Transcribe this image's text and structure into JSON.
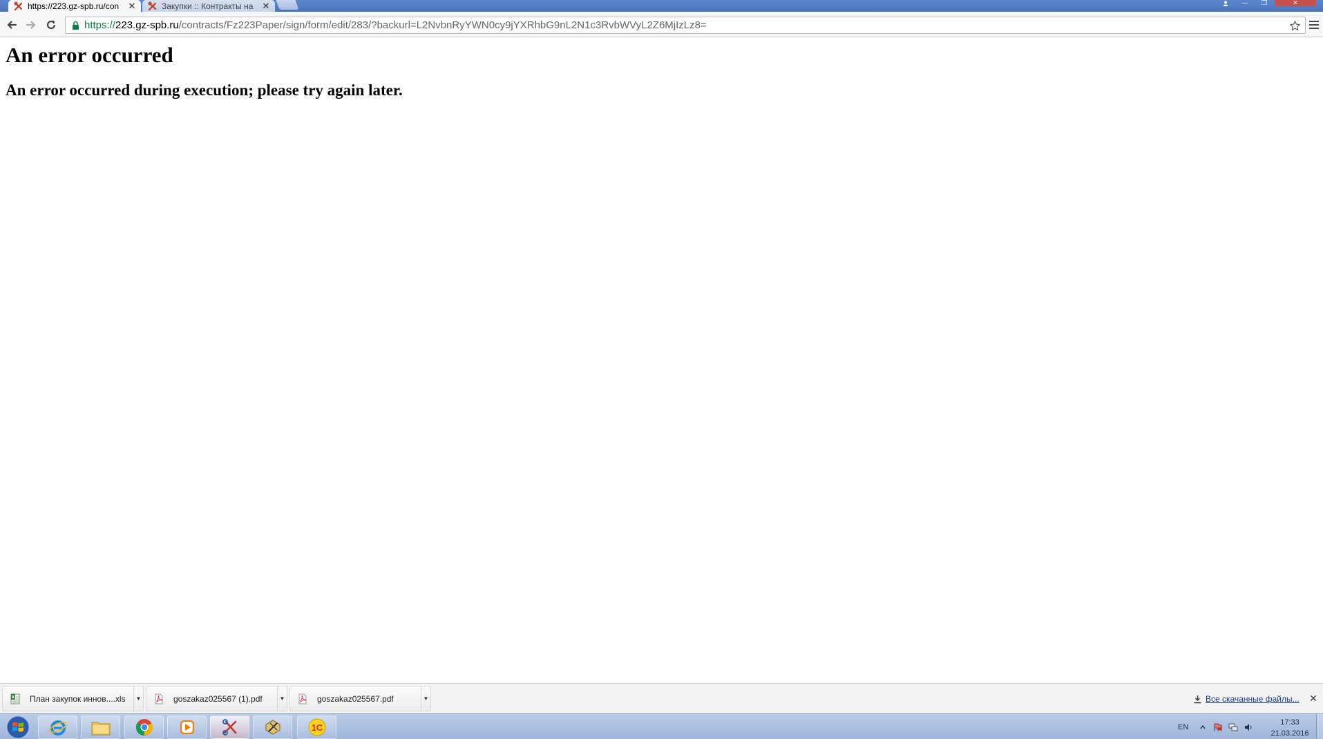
{
  "browser": {
    "tabs": [
      {
        "title": "https://223.gz-spb.ru/con",
        "close": "✕",
        "active": true
      },
      {
        "title": "Закупки :: Контракты на ",
        "close": "✕",
        "active": false
      }
    ],
    "window_controls": {
      "minimize": "—",
      "restore": "❐",
      "close": "✕"
    },
    "url": {
      "scheme": "https://",
      "host": "223.gz-spb.ru",
      "path": "/contracts/Fz223Paper/sign/form/edit/283/?backurl=L2NvbnRyYWN0cy9jYXRhbG9nL2N1c3RvbWVyL2Z6MjIzLz8="
    }
  },
  "page": {
    "heading": "An error occurred",
    "message": "An error occurred during execution; please try again later."
  },
  "downloads": {
    "items": [
      {
        "name": "План закупок иннов....xls",
        "icon": "excel-file-icon"
      },
      {
        "name": "goszakaz025567 (1).pdf",
        "icon": "pdf-file-icon"
      },
      {
        "name": "goszakaz025567.pdf",
        "icon": "pdf-file-icon"
      }
    ],
    "all_files_label": "Все скачанные файлы...",
    "close": "✕"
  },
  "taskbar": {
    "apps": [
      "internet-explorer-icon",
      "file-explorer-icon",
      "chrome-icon",
      "media-player-icon",
      "scissors-app-icon",
      "tools-app-icon",
      "1c-app-icon"
    ],
    "language": "EN",
    "time": "17:33",
    "date": "21.03.2016"
  },
  "colors": {
    "tabstrip": "#4a74bd",
    "url_scheme": "#0b8043",
    "taskbar": "#9fb6da"
  }
}
